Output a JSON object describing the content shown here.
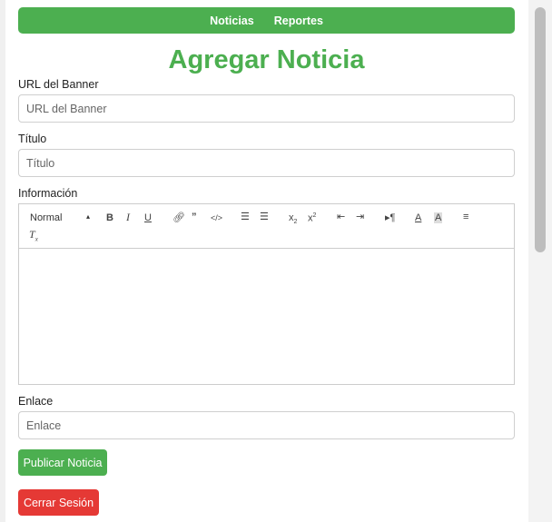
{
  "nav": {
    "items": [
      "Noticias",
      "Reportes"
    ]
  },
  "page": {
    "title": "Agregar Noticia"
  },
  "form": {
    "banner_label": "URL del Banner",
    "banner_placeholder": "URL del Banner",
    "title_label": "Título",
    "title_placeholder": "Título",
    "info_label": "Información",
    "link_label": "Enlace",
    "link_placeholder": "Enlace"
  },
  "editor": {
    "format_value": "Normal",
    "toolbar_icons": [
      "bold-icon",
      "italic-icon",
      "underline-icon",
      "link-icon",
      "blockquote-icon",
      "code-icon",
      "ordered-list-icon",
      "bullet-list-icon",
      "subscript-icon",
      "superscript-icon",
      "outdent-icon",
      "indent-icon",
      "rtl-icon",
      "text-color-icon",
      "background-color-icon",
      "align-icon",
      "clear-format-icon"
    ],
    "content": ""
  },
  "buttons": {
    "publish": "Publicar Noticia",
    "logout": "Cerrar Sesión"
  },
  "colors": {
    "accent": "#4caf50",
    "danger": "#e53935"
  }
}
